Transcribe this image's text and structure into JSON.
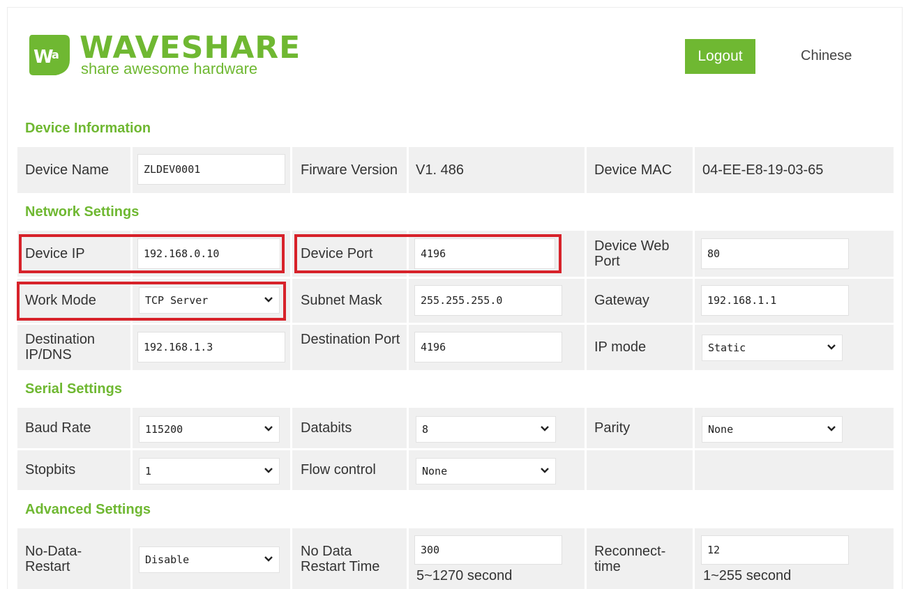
{
  "header": {
    "logo_word": "WAVESHARE",
    "logo_tagline": "share awesome hardware",
    "logout_label": "Logout",
    "language_link": "Chinese"
  },
  "colors": {
    "accent": "#6fb832",
    "highlight_box": "#d7222a",
    "row_bg": "#f0f0f0"
  },
  "device_info": {
    "title": "Device Information",
    "device_name_label": "Device Name",
    "device_name_value": "ZLDEV0001",
    "firmware_label": "Firware Version",
    "firmware_value": "V1. 486",
    "mac_label": "Device MAC",
    "mac_value": "04-EE-E8-19-03-65"
  },
  "network": {
    "title": "Network Settings",
    "device_ip_label": "Device IP",
    "device_ip_value": "192.168.0.10",
    "device_port_label": "Device Port",
    "device_port_value": "4196",
    "web_port_label": "Device Web Port",
    "web_port_value": "80",
    "work_mode_label": "Work Mode",
    "work_mode_value": "TCP Server",
    "subnet_label": "Subnet Mask",
    "subnet_value": "255.255.255.0",
    "gateway_label": "Gateway",
    "gateway_value": "192.168.1.1",
    "dest_ip_label": "Destination IP/DNS",
    "dest_ip_value": "192.168.1.3",
    "dest_port_label": "Destination Port",
    "dest_port_value": "4196",
    "ip_mode_label": "IP mode",
    "ip_mode_value": "Static"
  },
  "serial": {
    "title": "Serial Settings",
    "baud_label": "Baud Rate",
    "baud_value": "115200",
    "databits_label": "Databits",
    "databits_value": "8",
    "parity_label": "Parity",
    "parity_value": "None",
    "stopbits_label": "Stopbits",
    "stopbits_value": "1",
    "flow_label": "Flow control",
    "flow_value": "None"
  },
  "advanced": {
    "title": "Advanced Settings",
    "no_data_restart_label": "No-Data-Restart",
    "no_data_restart_value": "Disable",
    "restart_time_label": "No Data Restart Time",
    "restart_time_value": "300",
    "restart_time_hint": "5~1270 second",
    "reconnect_label": "Reconnect-time",
    "reconnect_value": "12",
    "reconnect_hint": "1~255 second"
  }
}
